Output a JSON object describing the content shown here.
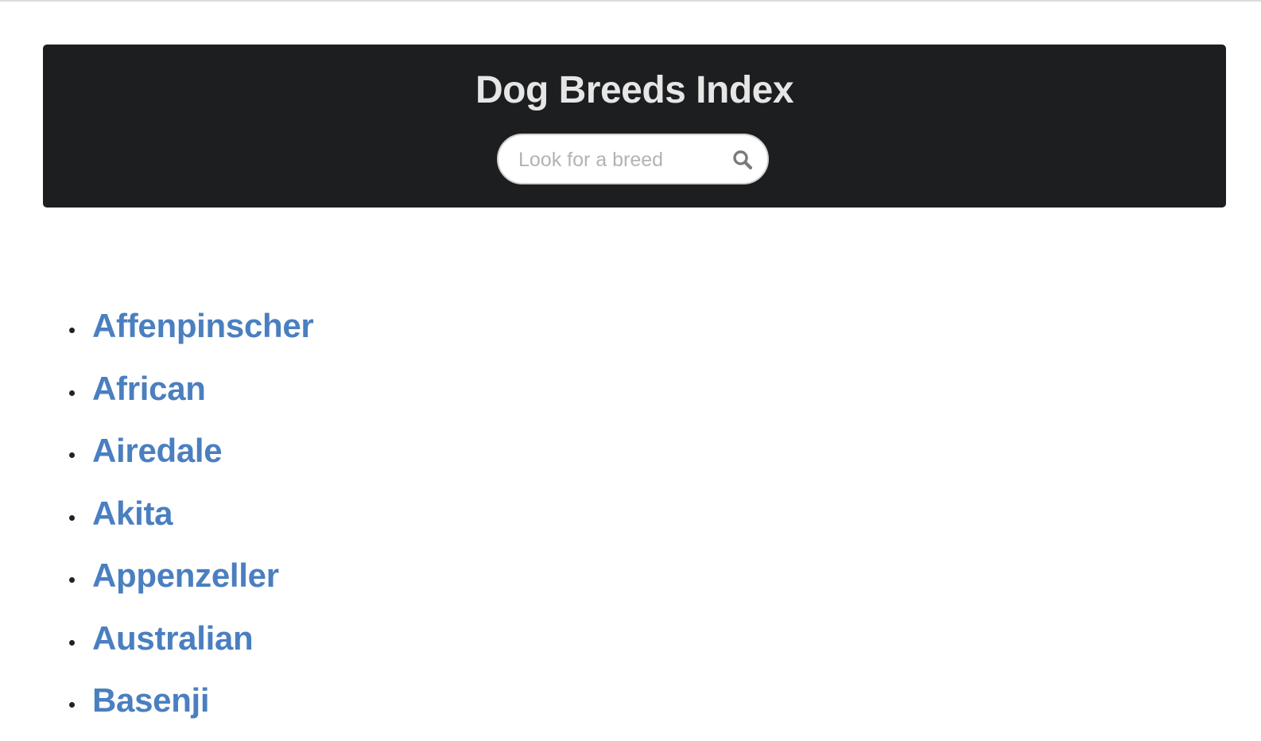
{
  "header": {
    "title": "Dog Breeds Index",
    "search_placeholder": "Look for a breed",
    "search_value": "",
    "search_icon": "search-icon"
  },
  "breeds": [
    {
      "label": "Affenpinscher"
    },
    {
      "label": "African"
    },
    {
      "label": "Airedale"
    },
    {
      "label": "Akita"
    },
    {
      "label": "Appenzeller"
    },
    {
      "label": "Australian"
    },
    {
      "label": "Basenji"
    }
  ],
  "colors": {
    "header_bg": "#1d1e20",
    "title": "#e6e6e6",
    "link": "#4a7fc0",
    "placeholder": "#b3b3b3"
  }
}
